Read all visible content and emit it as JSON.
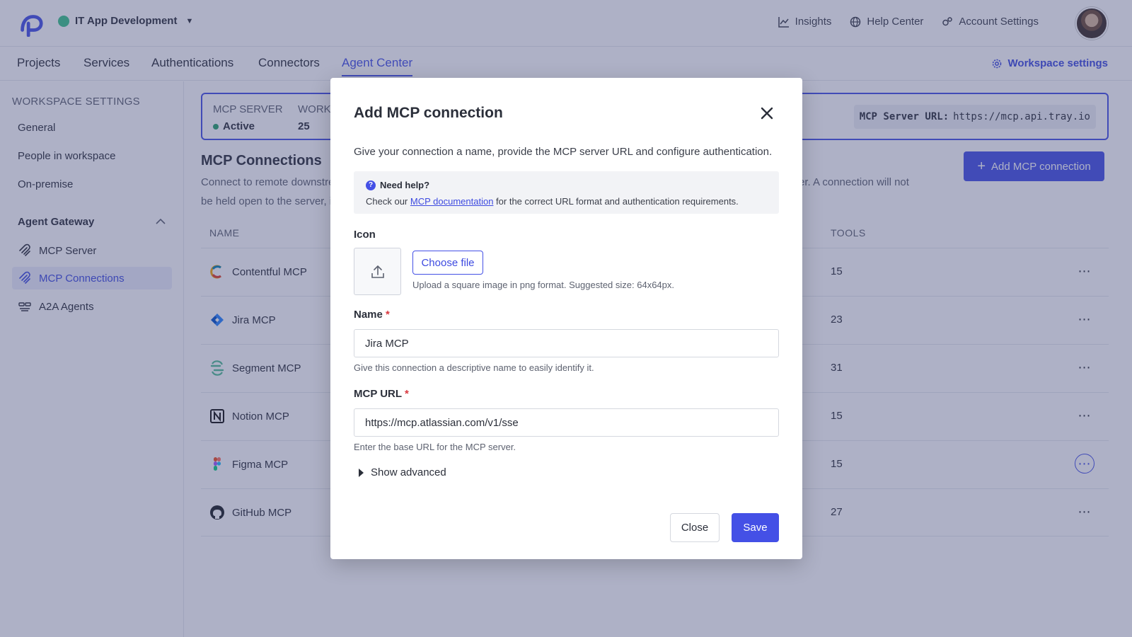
{
  "colors": {
    "accent": "#4450e6",
    "status_active": "#27a36b",
    "workspace_dot": "#3cc48a",
    "required": "#d9383f"
  },
  "topbar": {
    "workspace_name": "IT App Development",
    "links": [
      {
        "label": "Insights",
        "icon": "chart-line-icon"
      },
      {
        "label": "Help Center",
        "icon": "globe-icon"
      },
      {
        "label": "Account Settings",
        "icon": "gears-icon"
      }
    ]
  },
  "nav": {
    "tabs": [
      "Projects",
      "Services",
      "Authentications",
      "Connectors",
      "Agent Center"
    ],
    "active_tab": "Agent Center",
    "workspace_settings_label": "Workspace settings"
  },
  "sidebar": {
    "heading": "WORKSPACE SETTINGS",
    "items": [
      "General",
      "People in workspace",
      "On-premise"
    ],
    "group_label": "Agent Gateway",
    "group_items": [
      {
        "label": "MCP Server",
        "icon": "mcp-icon"
      },
      {
        "label": "MCP Connections",
        "icon": "mcp-icon",
        "active": true
      },
      {
        "label": "A2A Agents",
        "icon": "agents-icon"
      }
    ]
  },
  "status_card": {
    "server_label": "MCP SERVER",
    "server_value": "Active",
    "workspace_label": "WORK",
    "workspace_value": "25",
    "url_label": "MCP Server URL:",
    "url_value": "https://mcp.api.tray.io"
  },
  "connections": {
    "title": "MCP Connections",
    "desc_left_1": "Connect to remote downstre",
    "desc_right_1": "er.  A connection will not",
    "desc_left_2": "be held open to the server, i",
    "add_button": "Add MCP connection",
    "col_name": "NAME",
    "col_tools": "TOOLS",
    "rows": [
      {
        "name": "Contentful MCP",
        "tools": "15",
        "icon": "contentful-icon"
      },
      {
        "name": "Jira MCP",
        "tools": "23",
        "icon": "jira-icon"
      },
      {
        "name": "Segment MCP",
        "tools": "31",
        "icon": "segment-icon"
      },
      {
        "name": "Notion MCP",
        "tools": "15",
        "icon": "notion-icon"
      },
      {
        "name": "Figma MCP",
        "tools": "15",
        "icon": "figma-icon"
      },
      {
        "name": "GitHub MCP",
        "tools": "27",
        "icon": "github-icon"
      }
    ]
  },
  "modal": {
    "title": "Add MCP connection",
    "description": "Give your connection a name, provide the MCP server URL and configure authentication.",
    "help_title": "Need help?",
    "help_prefix": "Check our",
    "help_link": "MCP documentation",
    "help_suffix": "for the correct URL format and authentication requirements.",
    "icon_label": "Icon",
    "choose_file": "Choose file",
    "upload_hint": "Upload a square image in png format. Suggested size: 64x64px.",
    "name_label": "Name",
    "name_value": "Jira MCP",
    "name_hint": "Give this connection a descriptive name to easily identify it.",
    "url_label": "MCP URL",
    "url_value": "https://mcp.atlassian.com/v1/sse",
    "url_hint": "Enter the base URL for the MCP server.",
    "show_advanced": "Show advanced",
    "close_button": "Close",
    "save_button": "Save",
    "required_mark": "*"
  }
}
